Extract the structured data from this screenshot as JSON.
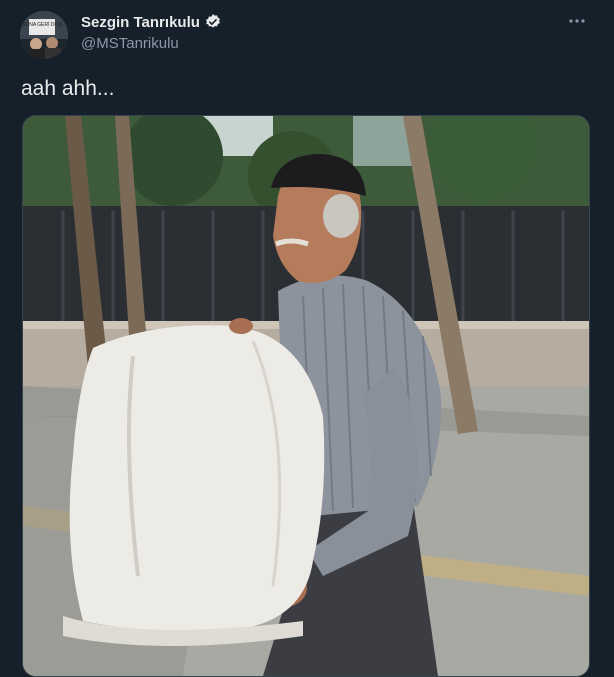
{
  "author": {
    "display_name": "Sezgin Tanrıkulu",
    "handle": "@MSTanrikulu",
    "verified": true,
    "avatar_icon": "profile-photo-icon",
    "avatar_sign_text": "SONA GERİ DÖN"
  },
  "tweet": {
    "text": "aah ahh..."
  },
  "menu": {
    "icon": "more-options-icon"
  },
  "colors": {
    "background": "#15202b",
    "verified_badge": "#e7e9ea",
    "handle": "#8b98a5"
  }
}
